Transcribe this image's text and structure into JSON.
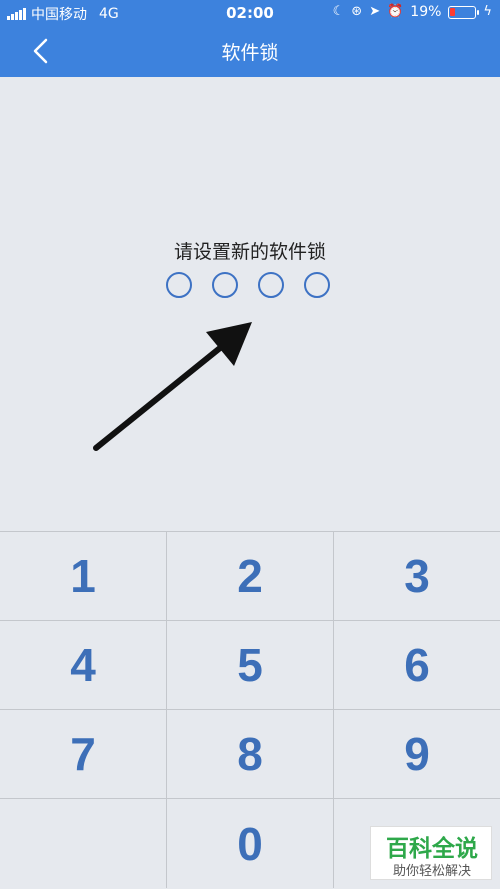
{
  "status_bar": {
    "carrier": "中国移动",
    "network": "4G",
    "time": "02:00",
    "battery": "19%",
    "icons": [
      "moon-icon",
      "rotation-lock-icon",
      "location-icon",
      "alarm-icon",
      "battery-icon",
      "charging-icon"
    ]
  },
  "nav": {
    "title": "软件锁",
    "back_icon": "chevron-left-icon"
  },
  "lock": {
    "prompt": "请设置新的软件锁",
    "dots_filled": 0,
    "dots_total": 4
  },
  "keypad": {
    "rows": [
      [
        "1",
        "2",
        "3"
      ],
      [
        "4",
        "5",
        "6"
      ],
      [
        "7",
        "8",
        "9"
      ],
      [
        "",
        "0",
        ""
      ]
    ]
  },
  "watermark": {
    "title": "百科全说",
    "subtitle": "助你轻松解决"
  },
  "colors": {
    "header": "#3d82dd",
    "background": "#e6e9ee",
    "key_text": "#3d6fb8",
    "dot_border": "#3d72c4"
  }
}
